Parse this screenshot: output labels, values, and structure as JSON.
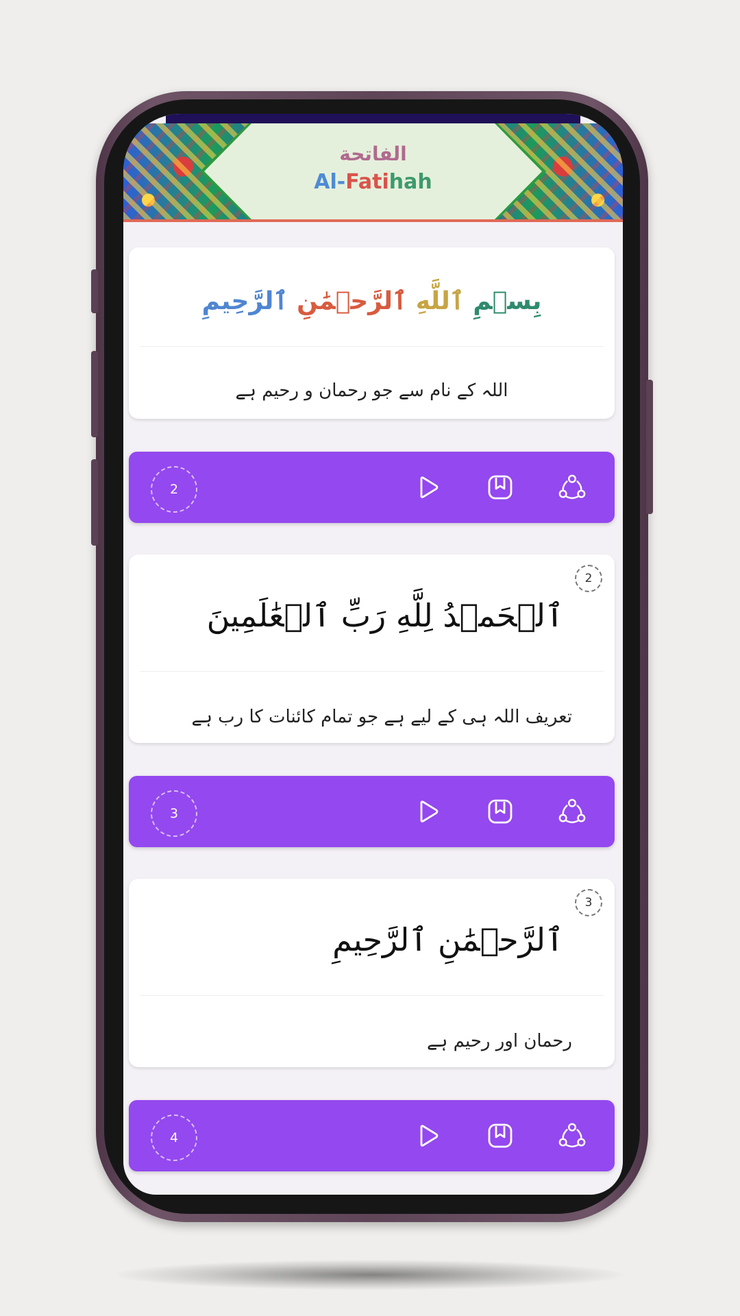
{
  "surah": {
    "arabic_name": "الفاتحة",
    "english_parts": [
      "Al-",
      "Fati",
      "hah"
    ]
  },
  "bismillah": {
    "words": [
      "بِسۡمِ",
      "ٱللَّهِ",
      "ٱلرَّحۡمَٰنِ",
      "ٱلرَّحِيمِ"
    ],
    "translation": "اللہ کے نام سے جو رحمان و رحیم ہے"
  },
  "ayahs": [
    {
      "number": "2",
      "arabic": "ٱلۡحَمۡدُ لِلَّهِ رَبِّ ٱلۡعَٰلَمِينَ",
      "translation": "تعریف اللہ ہی کے لیے ہے جو تمام کائنات کا رب ہے"
    },
    {
      "number": "3",
      "arabic": "ٱلرَّحۡمَٰنِ ٱلرَّحِيمِ",
      "translation": "رحمان اور رحیم ہے"
    }
  ],
  "action_bars": [
    {
      "number": "2"
    },
    {
      "number": "3"
    },
    {
      "number": "4"
    }
  ],
  "icons": {
    "play": "play-icon",
    "bookmark": "bookmark-icon",
    "share": "share-icon"
  },
  "colors": {
    "accent": "#9448ef",
    "status_strip": "#1f1057",
    "background": "#f4f1f6"
  }
}
